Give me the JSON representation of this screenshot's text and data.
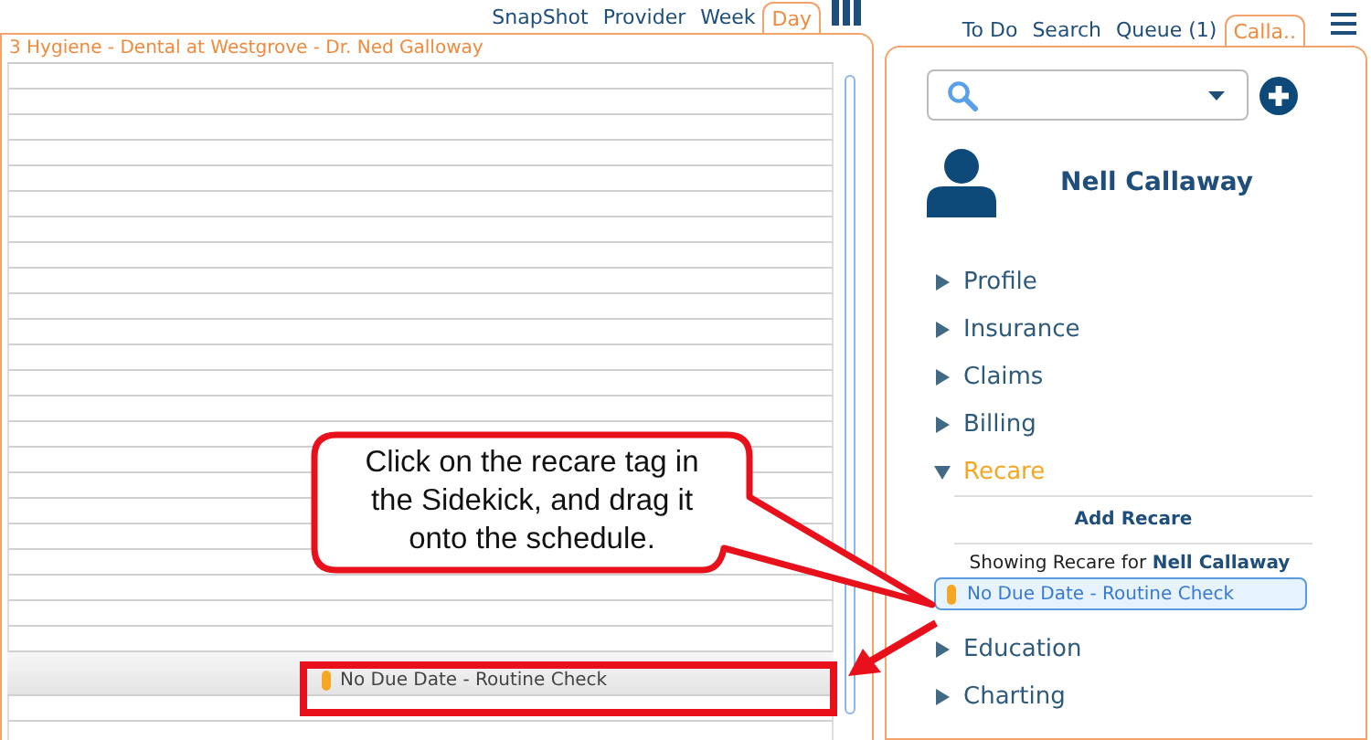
{
  "schedule_tabs": [
    {
      "label": "SnapShot",
      "selected": false
    },
    {
      "label": "Provider",
      "selected": false
    },
    {
      "label": "Week",
      "selected": false
    },
    {
      "label": "Day",
      "selected": true
    }
  ],
  "schedule": {
    "title": "3 Hygiene - Dental at Westgrove - Dr. Ned Galloway",
    "dragged_item": {
      "label": "No Due Date - Routine Check"
    }
  },
  "sidekick_tabs": [
    {
      "label": "To Do",
      "selected": false
    },
    {
      "label": "Search",
      "selected": false
    },
    {
      "label": "Queue (1)",
      "selected": false
    },
    {
      "label": "Calla..",
      "selected": true
    }
  ],
  "patient": {
    "name": "Nell Callaway"
  },
  "sections": [
    {
      "label": "Profile",
      "expanded": false
    },
    {
      "label": "Insurance",
      "expanded": false
    },
    {
      "label": "Claims",
      "expanded": false
    },
    {
      "label": "Billing",
      "expanded": false
    },
    {
      "label": "Recare",
      "expanded": true,
      "add_button": "Add Recare",
      "showing_text": "Showing Recare for  **Nell Callaway**",
      "tags": [
        "No Due Date - Routine Check"
      ]
    },
    {
      "label": "Education",
      "expanded": false
    },
    {
      "label": "Charting",
      "expanded": false
    }
  ],
  "callout": {
    "text": "Click on the recare tag in the Sidekick, and drag it onto the schedule."
  }
}
